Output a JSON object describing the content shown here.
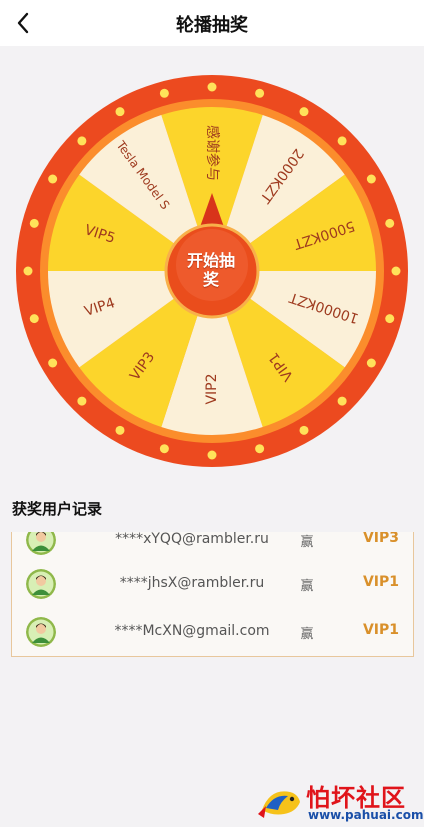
{
  "header": {
    "title": "轮播抽奖",
    "back_icon": "chevron-left-icon"
  },
  "wheel": {
    "start_label": "开始抽奖",
    "prizes": [
      "感谢参与",
      "2000KZT",
      "5000KZT",
      "10000KZT",
      "VIP1",
      "VIP2",
      "VIP3",
      "VIP4",
      "VIP5",
      "Tesla Model S"
    ],
    "colors": {
      "outer_ring": "#ec4a1f",
      "inner_ring": "#fb8d2c",
      "light_bulb": "#ffe25a",
      "segment_yellow": "#fcd52b",
      "segment_cream": "#fbf0d8",
      "prize_text": "#9e3a1f",
      "button": "#ea4d1c"
    }
  },
  "records": {
    "title": "获奖用户记录",
    "items": [
      {
        "email": "****xYQQ@rambler.ru",
        "result": "赢",
        "prize": "VIP3"
      },
      {
        "email": "****jhsX@rambler.ru",
        "result": "赢",
        "prize": "VIP1"
      },
      {
        "email": "****McXN@gmail.com",
        "result": "赢",
        "prize": "VIP1"
      }
    ],
    "avatar_icon": "user-avatar-icon"
  },
  "watermark": {
    "name": "怕坏社区",
    "url": "www.pahuai.com"
  }
}
